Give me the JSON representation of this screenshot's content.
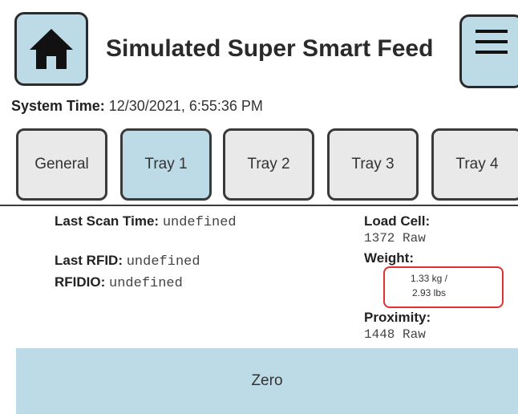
{
  "header": {
    "title": "Simulated Super Smart Feed",
    "home_icon": "home-icon",
    "menu_icon": "hamburger-menu-icon"
  },
  "system_time": {
    "label": "System Time:",
    "value": "12/30/2021, 6:55:36 PM"
  },
  "tabs": [
    {
      "label": "General",
      "active": false
    },
    {
      "label": "Tray 1",
      "active": true
    },
    {
      "label": "Tray 2",
      "active": false
    },
    {
      "label": "Tray 3",
      "active": false
    },
    {
      "label": "Tray 4",
      "active": false
    }
  ],
  "tray": {
    "last_scan_time": {
      "label": "Last Scan Time:",
      "value": "undefined"
    },
    "last_rfid": {
      "label": "Last RFID:",
      "value": "undefined"
    },
    "rfidio": {
      "label": "RFIDIO:",
      "value": "undefined"
    },
    "load_cell": {
      "label": "Load Cell:",
      "value": "1372 Raw"
    },
    "weight": {
      "label": "Weight:",
      "value_kg": "1.33 kg /",
      "value_lbs": "2.93 lbs"
    },
    "proximity": {
      "label": "Proximity:",
      "value": "1448 Raw"
    }
  },
  "actions": {
    "zero_label": "Zero"
  },
  "colors": {
    "accent": "#bcdbe6",
    "tab_inactive": "#e9e9e9",
    "highlight_border": "#e0302f"
  }
}
